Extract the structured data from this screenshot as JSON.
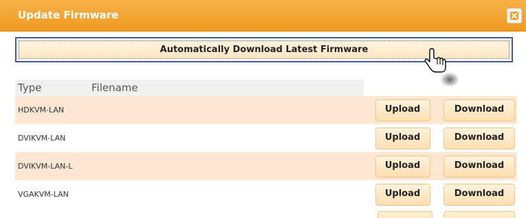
{
  "dialog": {
    "title": "Update Firmware",
    "close_label": "×"
  },
  "auto_download": {
    "label": "Automatically Download Latest Firmware"
  },
  "table": {
    "headers": {
      "type": "Type",
      "filename": "Filename"
    },
    "rows": [
      {
        "type": "HDKVM-LAN",
        "filename": "",
        "upload": "Upload",
        "download": "Download"
      },
      {
        "type": "DVIKVM-LAN",
        "filename": "",
        "upload": "Upload",
        "download": "Download"
      },
      {
        "type": "DVIKVM-LAN-L",
        "filename": "",
        "upload": "Upload",
        "download": "Download"
      },
      {
        "type": "VGAKVM-LAN",
        "filename": "",
        "upload": "Upload",
        "download": "Download"
      }
    ]
  },
  "colors": {
    "titlebar": "#ef9a1e",
    "row_highlight": "#fde7d3",
    "button_fill": "#fddfb2",
    "focus_border": "#3e5c9a"
  },
  "icons": {
    "close": "close-icon",
    "cursor": "hand-pointer-icon"
  }
}
